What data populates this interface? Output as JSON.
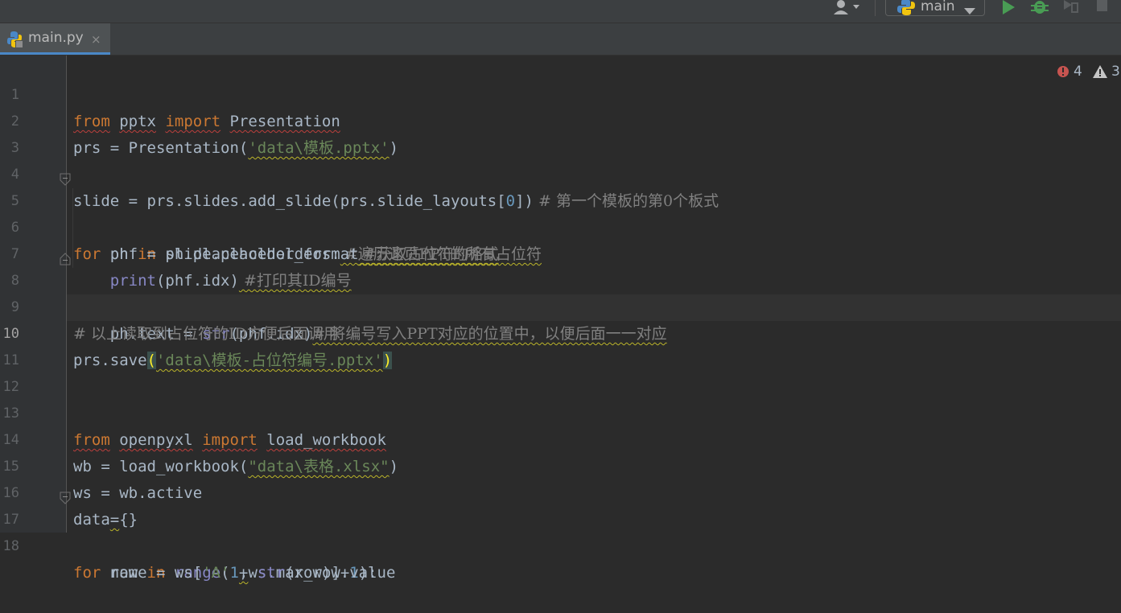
{
  "toolbar": {
    "run_config_label": "main",
    "colors": {
      "run": "#499c54",
      "debug": "#499c54"
    },
    "icons": [
      "user-icon",
      "python-icon",
      "chevron-down-icon",
      "run-icon",
      "debug-icon",
      "coverage-icon",
      "stop-icon"
    ]
  },
  "tab": {
    "label": "main.py",
    "close": "×"
  },
  "inspections": {
    "errors": "4",
    "warnings": "3"
  },
  "lines": {
    "l1": {
      "num": "1",
      "t": [
        "from",
        " ",
        "pptx",
        " ",
        "import",
        " ",
        "Presentation"
      ]
    },
    "l2": {
      "num": "2",
      "t": [
        "prs = Presentation(",
        "'data\\模板.pptx'",
        ")"
      ]
    },
    "l3": {
      "num": "3"
    },
    "l4": {
      "num": "4",
      "t": [
        "slide = prs.slides.add_slide(prs.slide_layouts[",
        "0",
        "])",
        " # 第一个模板的第0个板式"
      ]
    },
    "l5": {
      "num": "5",
      "t": [
        "for",
        " ph ",
        "in",
        " slide.placeholders:",
        " #遍历这页PPT的所有占位符"
      ]
    },
    "l6": {
      "num": "6",
      "t": [
        "    phf = ph.placeholder_format",
        " #获取占位符的格式"
      ]
    },
    "l7": {
      "num": "7",
      "t": [
        "    ",
        "print",
        "(phf.idx)",
        " #打印其ID编号"
      ]
    },
    "l8": {
      "num": "8",
      "t": [
        "    ph.text = ",
        "str",
        "(phf.idx)",
        "# 将编号写入PPT对应的位置中，以便后面一一对应"
      ]
    },
    "l9": {
      "num": "9",
      "t": [
        "# 以上读取到占位符的ID方便后面调用"
      ]
    },
    "l10": {
      "num": "10",
      "t": [
        "prs.save",
        "(",
        "'data\\模板-占位符编号.pptx'",
        ")"
      ]
    },
    "l11": {
      "num": "11"
    },
    "l12": {
      "num": "12"
    },
    "l13": {
      "num": "13",
      "t": [
        "from",
        " ",
        "openpyxl",
        " ",
        "import",
        " ",
        "load_workbook"
      ]
    },
    "l14": {
      "num": "14",
      "t": [
        "wb = load_workbook(",
        "\"data\\表格.xlsx\"",
        ")"
      ]
    },
    "l15": {
      "num": "15",
      "t": [
        "ws = wb.active"
      ]
    },
    "l16": {
      "num": "16",
      "t": [
        "data",
        "=",
        "{}"
      ]
    },
    "l17": {
      "num": "17",
      "t": [
        "for",
        " row ",
        "in",
        " ",
        "range",
        "(",
        "1",
        ",",
        "ws.max_row+",
        "1",
        "):"
      ]
    },
    "l18": {
      "num": "18",
      "t": [
        "    name = ws[",
        "'A'",
        " + ",
        "str",
        "(row)].value"
      ]
    }
  }
}
